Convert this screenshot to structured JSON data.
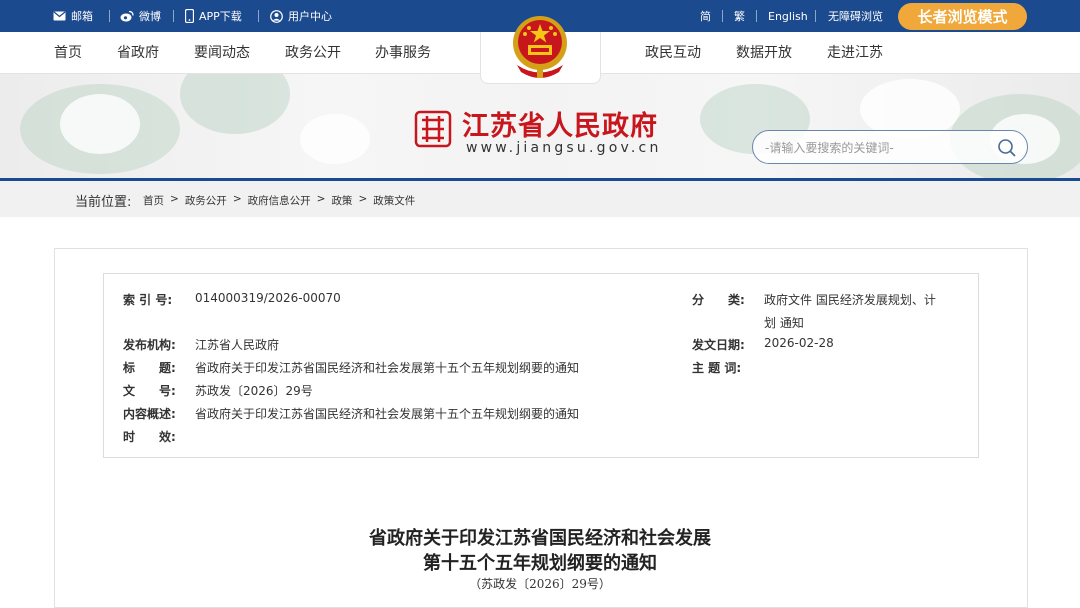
{
  "topbar": {
    "mail": "邮箱",
    "weibo": "微博",
    "app": "APP下载",
    "user": "用户中心",
    "simplified": "简",
    "traditional": "繁",
    "english": "English",
    "accessible": "无障碍浏览",
    "elder_mode": "长者浏览模式"
  },
  "nav": {
    "home": "首页",
    "province": "省政府",
    "news": "要闻动态",
    "affairs": "政务公开",
    "services": "办事服务",
    "interaction": "政民互动",
    "data": "数据开放",
    "jiangsu": "走进江苏"
  },
  "header": {
    "site_title": "江苏省人民政府",
    "site_url": "www.jiangsu.gov.cn",
    "search_placeholder": "-请输入要搜索的关键词-"
  },
  "breadcrumb": {
    "label": "当前位置:",
    "items": [
      "首页",
      "政务公开",
      "政府信息公开",
      "政策",
      "政策文件"
    ]
  },
  "meta": {
    "index_label": "索 引 号:",
    "index_value": "014000319/2026-00070",
    "category_label": "分　　类:",
    "category_value_1": "政府文件 国民经济发展规划、计",
    "category_value_2": "划 通知",
    "publisher_label": "发布机构:",
    "publisher_value": "江苏省人民政府",
    "date_label": "发文日期:",
    "date_value": "2026-02-28",
    "title_label": "标　　题:",
    "title_value": "省政府关于印发江苏省国民经济和社会发展第十五个五年规划纲要的通知",
    "subject_label": "主 题 词:",
    "doc_no_label": "文　　号:",
    "doc_no_value": "苏政发〔2026〕29号",
    "summary_label": "内容概述:",
    "summary_value": "省政府关于印发江苏省国民经济和社会发展第十五个五年规划纲要的通知",
    "validity_label": "时　　效:"
  },
  "document": {
    "title_line1": "省政府关于印发江苏省国民经济和社会发展",
    "title_line2": "第十五个五年规划纲要的通知",
    "number": "（苏政发〔2026〕29号）"
  },
  "colors": {
    "top_bar": "#1c4a8f",
    "elder_button": "#f0a83a",
    "title_red": "#c8161d"
  }
}
